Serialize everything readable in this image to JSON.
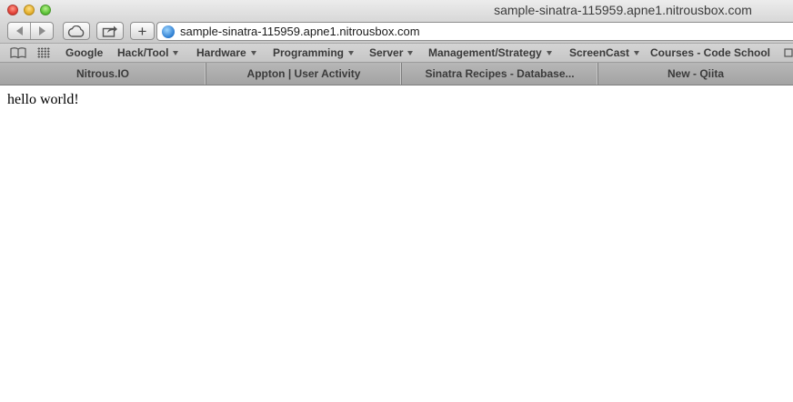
{
  "window": {
    "title": "sample-sinatra-115959.apne1.nitrousbox.com"
  },
  "toolbar": {
    "back_icon": "back-arrow-icon",
    "forward_icon": "forward-arrow-icon",
    "cloud_icon": "icloud-tabs-icon",
    "share_icon": "share-icon",
    "plus_label": "+",
    "address": {
      "url": "sample-sinatra-115959.apne1.nitrousbox.com",
      "icon": "globe-icon"
    }
  },
  "bookmarks": {
    "items": [
      {
        "label": "Google",
        "menu": false
      },
      {
        "label": "Hack/Tool",
        "menu": true
      },
      {
        "label": "Hardware",
        "menu": true
      },
      {
        "label": "Programming",
        "menu": true
      },
      {
        "label": "Server",
        "menu": true
      },
      {
        "label": "Management/Strategy",
        "menu": true
      },
      {
        "label": "ScreenCast",
        "menu": true
      },
      {
        "label": "Courses - Code School",
        "menu": false
      }
    ]
  },
  "tabs": [
    {
      "label": "Nitrous.IO"
    },
    {
      "label": "Appton | User Activity"
    },
    {
      "label": "Sinatra Recipes - Database..."
    },
    {
      "label": "New - Qiita"
    }
  ],
  "page": {
    "body_text": "hello world!"
  },
  "colors": {
    "accent_globe": "#2a7bd0",
    "chrome": "#d4d4d4"
  }
}
